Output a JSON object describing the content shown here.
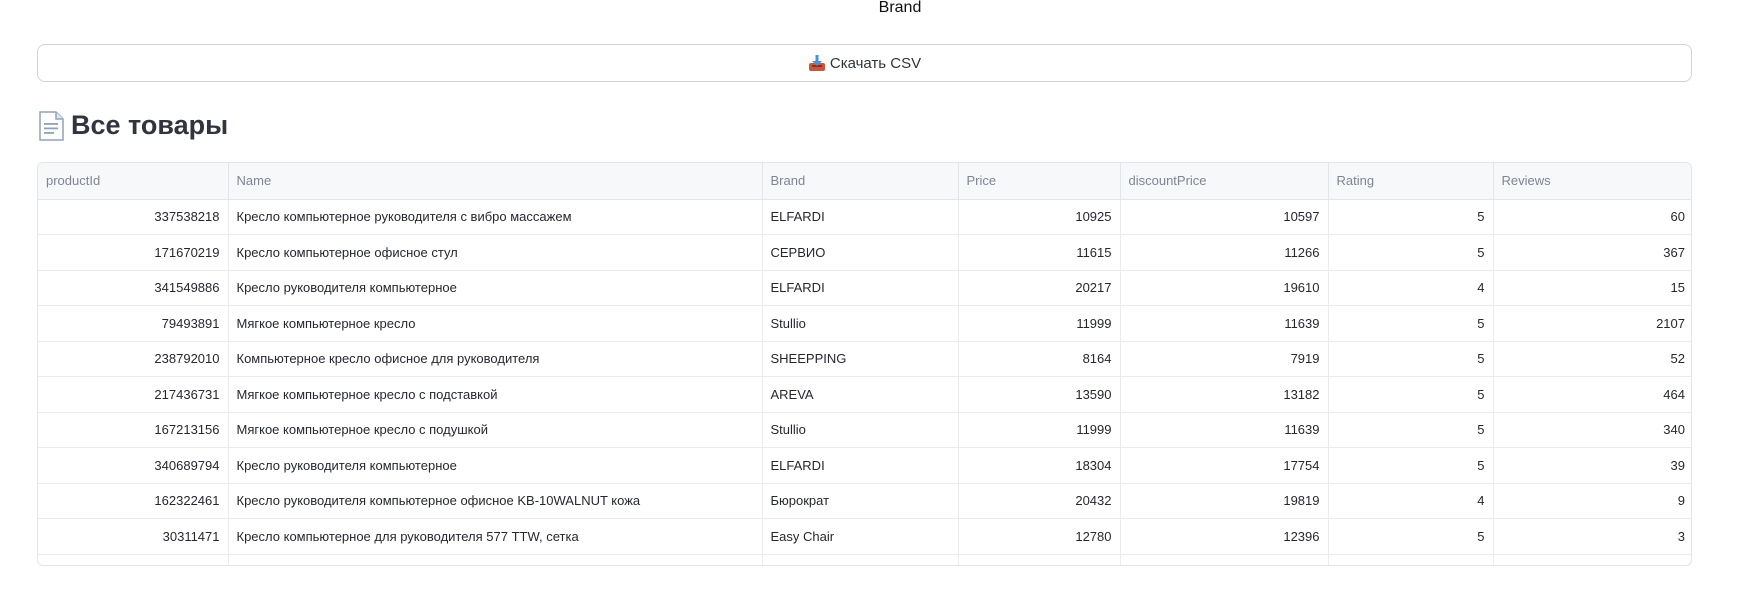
{
  "filter_label": "Brand",
  "download": {
    "label": "Скачать CSV",
    "icon": "inbox-tray-icon"
  },
  "section": {
    "title": "Все товары",
    "icon": "page-icon"
  },
  "table": {
    "columns": [
      "productId",
      "Name",
      "Brand",
      "Price",
      "discountPrice",
      "Rating",
      "Reviews"
    ],
    "rows": [
      {
        "productId": "337538218",
        "name": "Кресло компьютерное руководителя с вибро массажем",
        "brand": "ELFARDI",
        "price": "10925",
        "discountPrice": "10597",
        "rating": "5",
        "reviews": "60"
      },
      {
        "productId": "171670219",
        "name": "Кресло компьютерное офисное стул",
        "brand": "СЕРВИО",
        "price": "11615",
        "discountPrice": "11266",
        "rating": "5",
        "reviews": "367"
      },
      {
        "productId": "341549886",
        "name": "Кресло руководителя компьютерное",
        "brand": "ELFARDI",
        "price": "20217",
        "discountPrice": "19610",
        "rating": "4",
        "reviews": "15"
      },
      {
        "productId": "79493891",
        "name": "Мягкое компьютерное кресло",
        "brand": "Stullio",
        "price": "11999",
        "discountPrice": "11639",
        "rating": "5",
        "reviews": "2107"
      },
      {
        "productId": "238792010",
        "name": "Компьютерное кресло офисное для руководителя",
        "brand": "SHEEPPING",
        "price": "8164",
        "discountPrice": "7919",
        "rating": "5",
        "reviews": "52"
      },
      {
        "productId": "217436731",
        "name": "Мягкое компьютерное кресло с подставкой",
        "brand": "AREVA",
        "price": "13590",
        "discountPrice": "13182",
        "rating": "5",
        "reviews": "464"
      },
      {
        "productId": "167213156",
        "name": "Мягкое компьютерное кресло с подушкой",
        "brand": "Stullio",
        "price": "11999",
        "discountPrice": "11639",
        "rating": "5",
        "reviews": "340"
      },
      {
        "productId": "340689794",
        "name": "Кресло руководителя компьютерное",
        "brand": "ELFARDI",
        "price": "18304",
        "discountPrice": "17754",
        "rating": "5",
        "reviews": "39"
      },
      {
        "productId": "162322461",
        "name": "Кресло руководителя компьютерное офисное KB-10WALNUT кожа",
        "brand": "Бюрократ",
        "price": "20432",
        "discountPrice": "19819",
        "rating": "4",
        "reviews": "9"
      },
      {
        "productId": "30311471",
        "name": "Кресло компьютерное для руководителя 577 TTW, сетка",
        "brand": "Easy Chair",
        "price": "12780",
        "discountPrice": "12396",
        "rating": "5",
        "reviews": "3"
      }
    ]
  },
  "colors": {
    "text": "#31333f",
    "header_text": "#808495",
    "header_bg": "#f7f8fa",
    "border": "#e3e5ea"
  }
}
